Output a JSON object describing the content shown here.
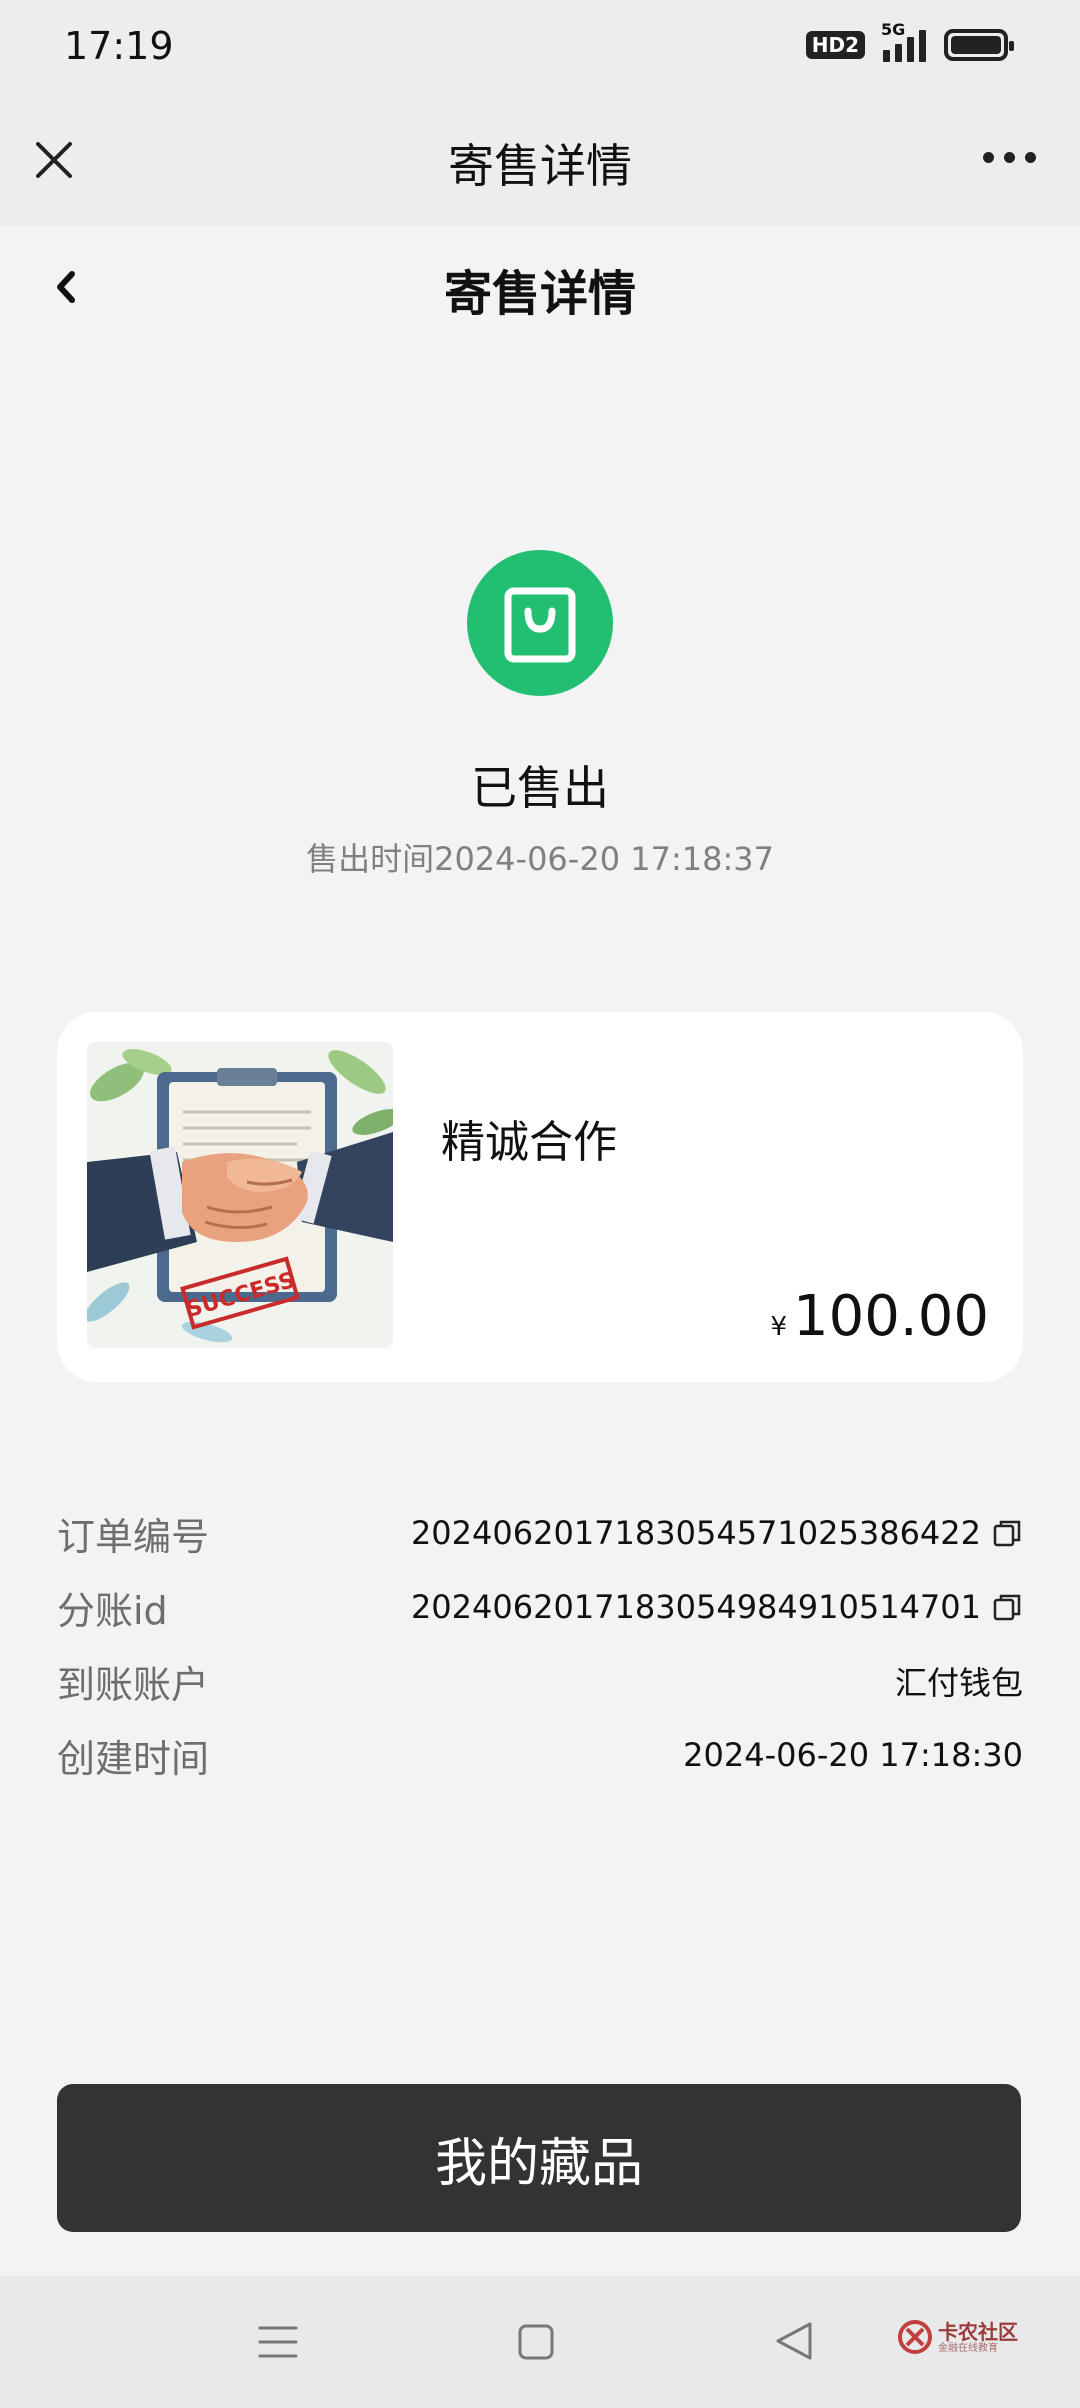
{
  "status_bar": {
    "time": "17:19",
    "hd_badge": "HD2",
    "network": "5G"
  },
  "wechat_header": {
    "title": "寄售详情"
  },
  "page": {
    "title": "寄售详情"
  },
  "order_status": {
    "icon": "shopping-bag-icon",
    "icon_color": "#22bf72",
    "label": "已售出",
    "sold_time_prefix": "售出时间",
    "sold_time": "2024-06-20 17:18:37"
  },
  "product": {
    "name": "精诚合作",
    "currency": "¥",
    "price": "100.00",
    "image_stamp": "SUCCESS"
  },
  "details": [
    {
      "label": "订单编号",
      "value": "202406201718305457102538642​2",
      "copy": true
    },
    {
      "label": "分账id",
      "value": "20240620171830549849105147​01",
      "copy": true
    },
    {
      "label": "到账账户",
      "value": "汇付钱包",
      "copy": false
    },
    {
      "label": "创建时间",
      "value": "2024-06-20 17:18:30",
      "copy": false
    }
  ],
  "actions": {
    "my_collection": "我的藏品"
  },
  "watermark": {
    "name": "卡农社区",
    "sub": "金融在线教育"
  }
}
